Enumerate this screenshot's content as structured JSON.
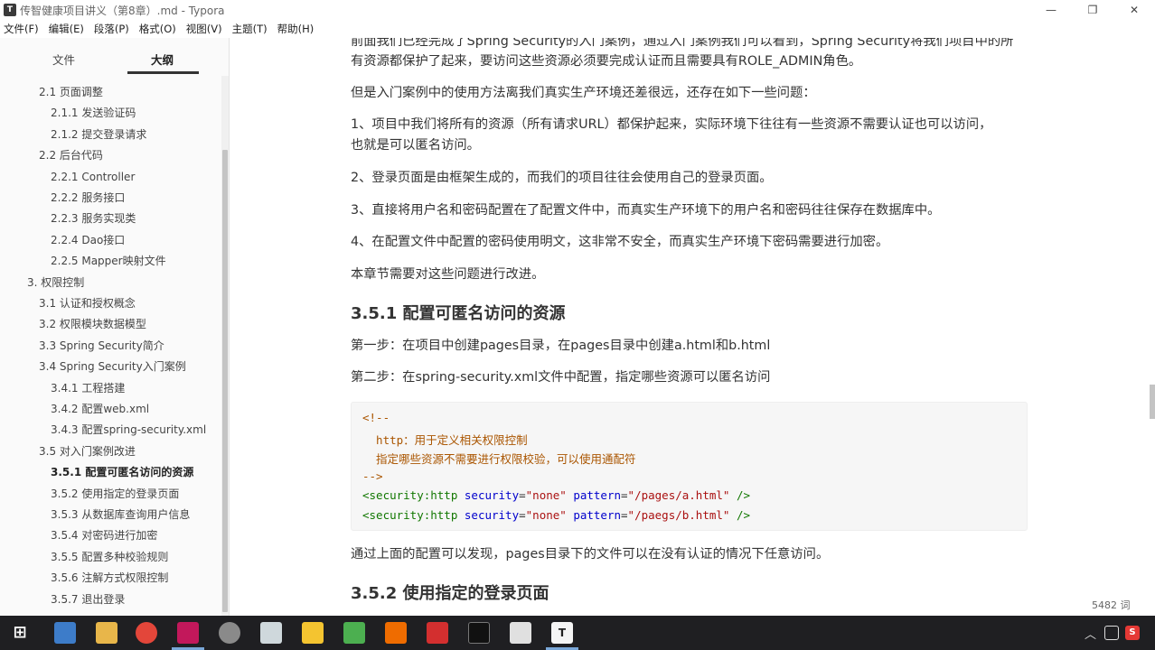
{
  "window": {
    "title": "传智健康项目讲义（第8章）.md - Typora",
    "app_icon": "T",
    "minimize": "—",
    "restore": "❐",
    "close": "✕"
  },
  "menu": [
    "文件(F)",
    "编辑(E)",
    "段落(P)",
    "格式(O)",
    "视图(V)",
    "主题(T)",
    "帮助(H)"
  ],
  "sidebar": {
    "tabs": [
      "文件",
      "大纲"
    ],
    "outline": [
      {
        "label": "2.1 页面调整",
        "level": 1
      },
      {
        "label": "2.1.1 发送验证码",
        "level": 2
      },
      {
        "label": "2.1.2 提交登录请求",
        "level": 2
      },
      {
        "label": "2.2 后台代码",
        "level": 1
      },
      {
        "label": "2.2.1 Controller",
        "level": 2
      },
      {
        "label": "2.2.2 服务接口",
        "level": 2
      },
      {
        "label": "2.2.3 服务实现类",
        "level": 2
      },
      {
        "label": "2.2.4 Dao接口",
        "level": 2
      },
      {
        "label": "2.2.5 Mapper映射文件",
        "level": 2
      },
      {
        "label": "3. 权限控制",
        "level": 0
      },
      {
        "label": "3.1 认证和授权概念",
        "level": 1
      },
      {
        "label": "3.2 权限模块数据模型",
        "level": 1
      },
      {
        "label": "3.3 Spring Security简介",
        "level": 1
      },
      {
        "label": "3.4 Spring Security入门案例",
        "level": 1
      },
      {
        "label": "3.4.1 工程搭建",
        "level": 2
      },
      {
        "label": "3.4.2 配置web.xml",
        "level": 2
      },
      {
        "label": "3.4.3 配置spring-security.xml",
        "level": 2
      },
      {
        "label": "3.5 对入门案例改进",
        "level": 1
      },
      {
        "label": "3.5.1 配置可匿名访问的资源",
        "level": 2,
        "active": true
      },
      {
        "label": "3.5.2 使用指定的登录页面",
        "level": 2
      },
      {
        "label": "3.5.3 从数据库查询用户信息",
        "level": 2
      },
      {
        "label": "3.5.4 对密码进行加密",
        "level": 2
      },
      {
        "label": "3.5.5 配置多种校验规则",
        "level": 2
      },
      {
        "label": "3.5.6 注解方式权限控制",
        "level": 2
      },
      {
        "label": "3.5.7 退出登录",
        "level": 2
      }
    ],
    "bottom_left": "‹",
    "bottom_code": "</>"
  },
  "content": {
    "p1_line1": "前面我们已经完成了Spring Security的入门案例，通过入门案例我们可以看到，Spring Security将我们项目中的所",
    "p1_line2": "有资源都保护了起来，要访问这些资源必须要完成认证而且需要具有ROLE_ADMIN角色。",
    "p2": "但是入门案例中的使用方法离我们真实生产环境还差很远，还存在如下一些问题：",
    "p3_line1": "1、项目中我们将所有的资源（所有请求URL）都保护起来，实际环境下往往有一些资源不需要认证也可以访问，",
    "p3_line2": "也就是可以匿名访问。",
    "p4": "2、登录页面是由框架生成的，而我们的项目往往会使用自己的登录页面。",
    "p5": "3、直接将用户名和密码配置在了配置文件中，而真实生产环境下的用户名和密码往往保存在数据库中。",
    "p6": "4、在配置文件中配置的密码使用明文，这非常不安全，而真实生产环境下密码需要进行加密。",
    "p7": "本章节需要对这些问题进行改进。",
    "h1": "3.5.1 配置可匿名访问的资源",
    "p8": "第一步：在项目中创建pages目录，在pages目录中创建a.html和b.html",
    "p9": "第二步：在spring-security.xml文件中配置，指定哪些资源可以匿名访问",
    "code": {
      "c1": "<!--",
      "c2": "  http：用于定义相关权限控制",
      "c3": "  指定哪些资源不需要进行权限校验，可以使用通配符",
      "c4": "-->",
      "line5": {
        "tag": "<security:http",
        "attr1": "security",
        "val1": "\"none\"",
        "attr2": "pattern",
        "val2": "\"/pages/a.html\"",
        "end": "/>"
      },
      "line6": {
        "tag": "<security:http",
        "attr1": "security",
        "val1": "\"none\"",
        "attr2": "pattern",
        "val2": "\"/paegs/b.html\"",
        "end": "/>"
      }
    },
    "p10": "通过上面的配置可以发现，pages目录下的文件可以在没有认证的情况下任意访问。",
    "h2": "3.5.2 使用指定的登录页面",
    "wordcount": "5482 词"
  },
  "taskbar": {
    "start": "⊞",
    "tray_up": "︿",
    "tray_ime": "S"
  }
}
